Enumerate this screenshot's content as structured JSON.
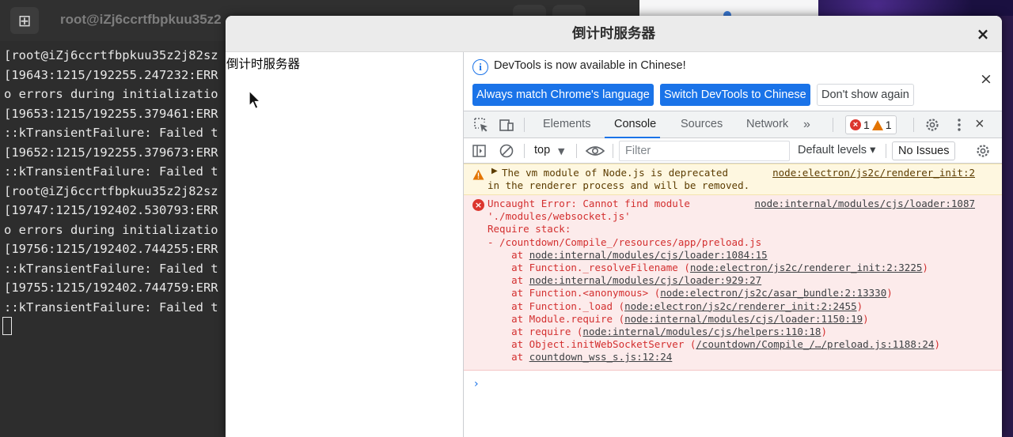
{
  "terminal": {
    "title": "root@iZj6ccrtfbpkuu35z2",
    "lines": [
      "[root@iZj6ccrtfbpkuu35z2j82sz",
      "[19643:1215/192255.247232:ERR",
      "o errors during initializatio",
      "[19653:1215/192255.379461:ERR",
      "::kTransientFailure: Failed t",
      "[19652:1215/192255.379673:ERR",
      "::kTransientFailure: Failed t",
      "[root@iZj6ccrtfbpkuu35z2j82sz",
      "[19747:1215/192402.530793:ERR",
      "o errors during initializatio",
      "[19756:1215/192402.744255:ERR",
      "::kTransientFailure: Failed t",
      "[19755:1215/192402.744759:ERR",
      "::kTransientFailure: Failed t"
    ]
  },
  "app": {
    "title": "倒计时服务器",
    "close": "×",
    "page_heading": "倒计时服务器"
  },
  "devtools": {
    "infobar": {
      "message": "DevTools is now available in Chinese!",
      "btn_match": "Always match Chrome's language",
      "btn_switch": "Switch DevTools to Chinese",
      "btn_dismiss": "Don't show again",
      "close": "×"
    },
    "tabs": [
      "Elements",
      "Console",
      "Sources",
      "Network"
    ],
    "more": "»",
    "error_count": "1",
    "warning_count": "1",
    "close": "×",
    "context": "top",
    "filter_placeholder": "Filter",
    "levels": "Default levels ▾",
    "no_issues": "No Issues",
    "warning": {
      "line1": "The vm module of Node.js is deprecated",
      "line2": "in the renderer process and will be removed.",
      "source": "node:electron/js2c/renderer_init:2"
    },
    "error": {
      "source": "node:internal/modules/cjs/loader:1087",
      "line1": "Uncaught Error: Cannot find module",
      "line2": "'./modules/websocket.js'",
      "line3": "Require stack:",
      "line4": "- /countdown/Compile_/resources/app/preload.js",
      "stack": [
        {
          "prefix": "    at ",
          "link": "node:internal/modules/cjs/loader:1084:15",
          "wrap": false
        },
        {
          "prefix": "    at Function._resolveFilename (",
          "link": "node:electron/js2c/renderer_init:2:3225",
          "wrap": true
        },
        {
          "prefix": "    at ",
          "link": "node:internal/modules/cjs/loader:929:27",
          "wrap": false
        },
        {
          "prefix": "    at Function.<anonymous> (",
          "link": "node:electron/js2c/asar_bundle:2:13330",
          "wrap": true
        },
        {
          "prefix": "    at Function._load (",
          "link": "node:electron/js2c/renderer_init:2:2455",
          "wrap": true
        },
        {
          "prefix": "    at Module.require (",
          "link": "node:internal/modules/cjs/loader:1150:19",
          "wrap": true
        },
        {
          "prefix": "    at require (",
          "link": "node:internal/modules/cjs/helpers:110:18",
          "wrap": true
        },
        {
          "prefix": "    at Object.initWebSocketServer (",
          "link": "/countdown/Compile_/…/preload.js:1188:24",
          "wrap": true
        },
        {
          "prefix": "    at ",
          "link": "countdown_wss_s.js:12:24",
          "wrap": false
        }
      ]
    },
    "prompt": "›"
  },
  "colors": {
    "accent": "#1a73e8",
    "error": "#d32f2f",
    "warning_bg": "#fef7e0",
    "error_bg": "#fcebeb",
    "terminal_bg": "#2d2d2d"
  }
}
